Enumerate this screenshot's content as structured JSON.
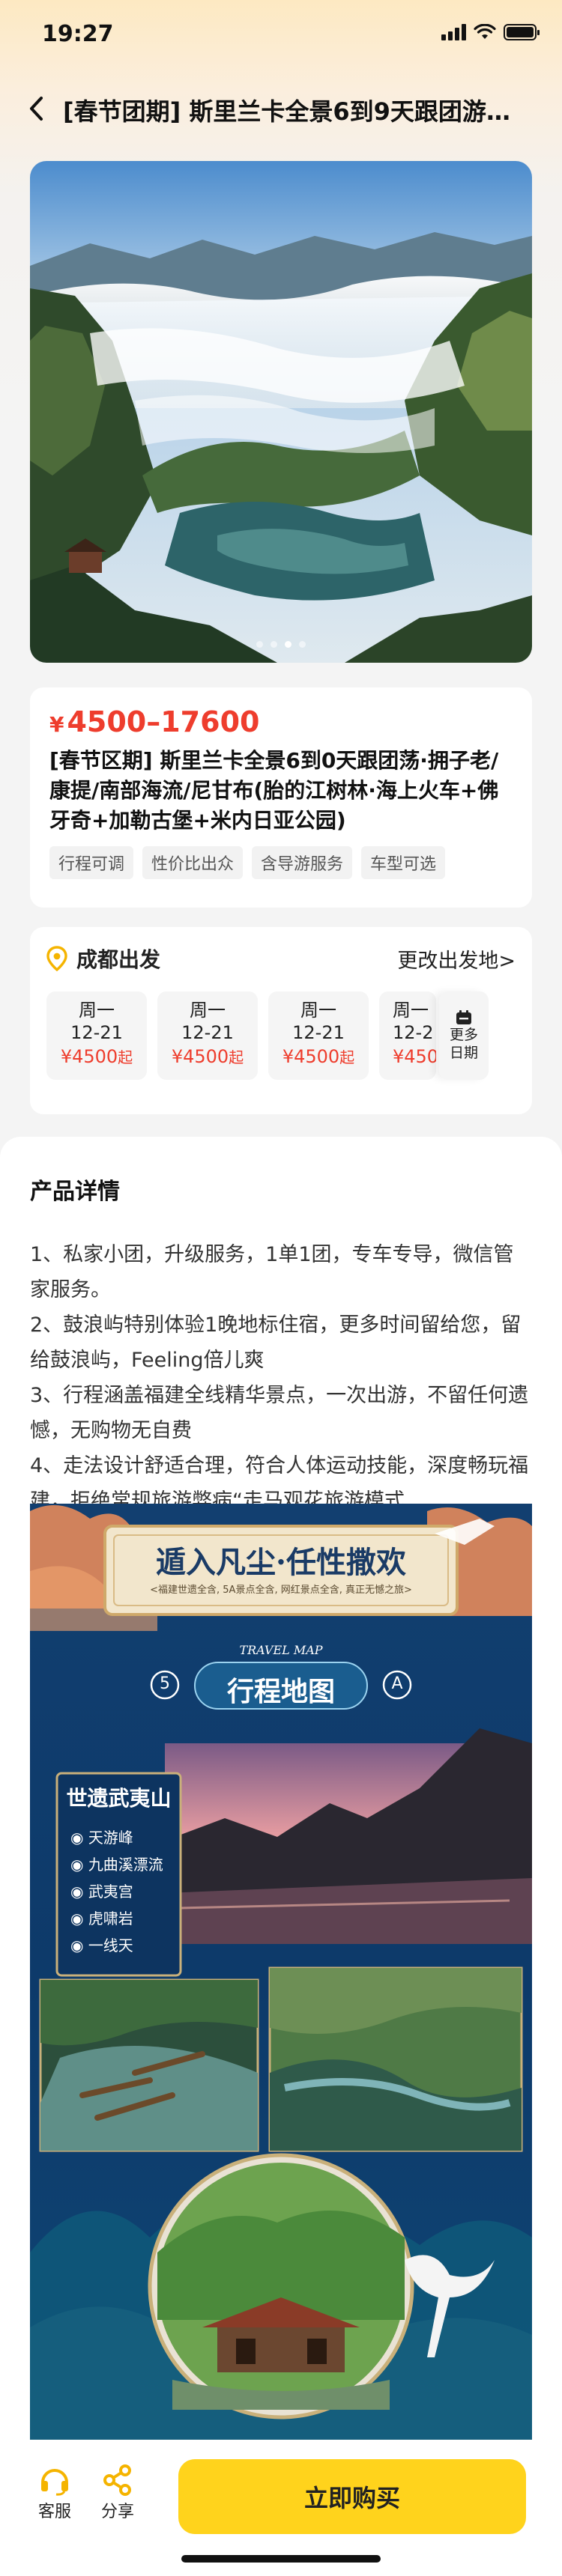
{
  "status": {
    "time": "19:27"
  },
  "nav": {
    "title": "[春节团期] 斯里兰卡全景6到9天跟团游..."
  },
  "hero": {
    "slide_count": 4,
    "active_slide": 3
  },
  "product": {
    "currency": "¥",
    "price_range": "4500–17600",
    "title": "[春节区期] 斯里兰卡全景6到0天跟团荡·拥子老/康提/南部海流/尼甘布(胎的江树林·海上火车+佛牙奇+加勒古堡+米内日亚公园)",
    "tags": [
      "行程可调",
      "性价比出众",
      "含导游服务",
      "车型可选"
    ]
  },
  "departure": {
    "city": "成都出发",
    "change_label": "更改出发地>",
    "dates": [
      {
        "weekday": "周一",
        "date": "12-21",
        "price": "¥4500",
        "suffix": "起"
      },
      {
        "weekday": "周一",
        "date": "12-21",
        "price": "¥4500",
        "suffix": "起"
      },
      {
        "weekday": "周一",
        "date": "12-21",
        "price": "¥4500",
        "suffix": "起"
      },
      {
        "weekday": "周一",
        "date": "12-2",
        "price": "¥450",
        "suffix": ""
      }
    ],
    "more_label_1": "更多",
    "more_label_2": "日期"
  },
  "details": {
    "title": "产品详情",
    "lines": [
      "1、私家小团，升级服务，1单1团，专车专导，微信管家服务。",
      "2、鼓浪屿特别体验1晚地标住宿，更多时间留给您，留给鼓浪屿，Feeling倍儿爽",
      "3、行程涵盖福建全线精华景点，一次出游，不留任何遗憾，无购物无自费",
      "4、走法设计舒适合理，符合人体运动技能，深度畅玩福建，拒绝常规旅游弊病“走马观花旅游模式"
    ]
  },
  "poster": {
    "headline": "遁入凡尘·任性撒欢",
    "subline": "<福建世遗全含, 5A景点全含, 网红景点全含, 真正无憾之旅>",
    "map_en": "TRAVEL MAP",
    "map_title": "行程地图",
    "badge_left": "5",
    "badge_right": "A",
    "vertical_title": "世遗武夷山",
    "spots": [
      "天游峰",
      "九曲溪漂流",
      "武夷宫",
      "虎啸岩",
      "一线天"
    ]
  },
  "bottom": {
    "service_label": "客服",
    "share_label": "分享",
    "buy_label": "立即购买"
  },
  "colors": {
    "accent": "#ffd31c",
    "price": "#ee3d2d"
  }
}
